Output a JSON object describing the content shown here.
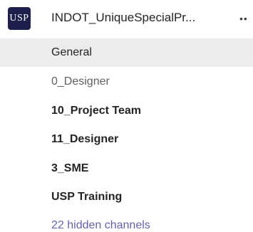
{
  "team": {
    "avatar_text": "USP",
    "name": "INDOT_UniqueSpecialPr...",
    "more_icon": "ellipsis-icon"
  },
  "channels": [
    {
      "label": "General",
      "style": "selected"
    },
    {
      "label": "0_Designer",
      "style": "muted"
    },
    {
      "label": "10_Project Team",
      "style": "bold"
    },
    {
      "label": "11_Designer",
      "style": "bold"
    },
    {
      "label": "3_SME",
      "style": "bold"
    },
    {
      "label": "USP Training",
      "style": "bold"
    }
  ],
  "hidden_channels_link": "22 hidden channels",
  "colors": {
    "avatar_bg": "#1e1f4b",
    "selected_bg": "#ececec",
    "link": "#6264a7"
  }
}
